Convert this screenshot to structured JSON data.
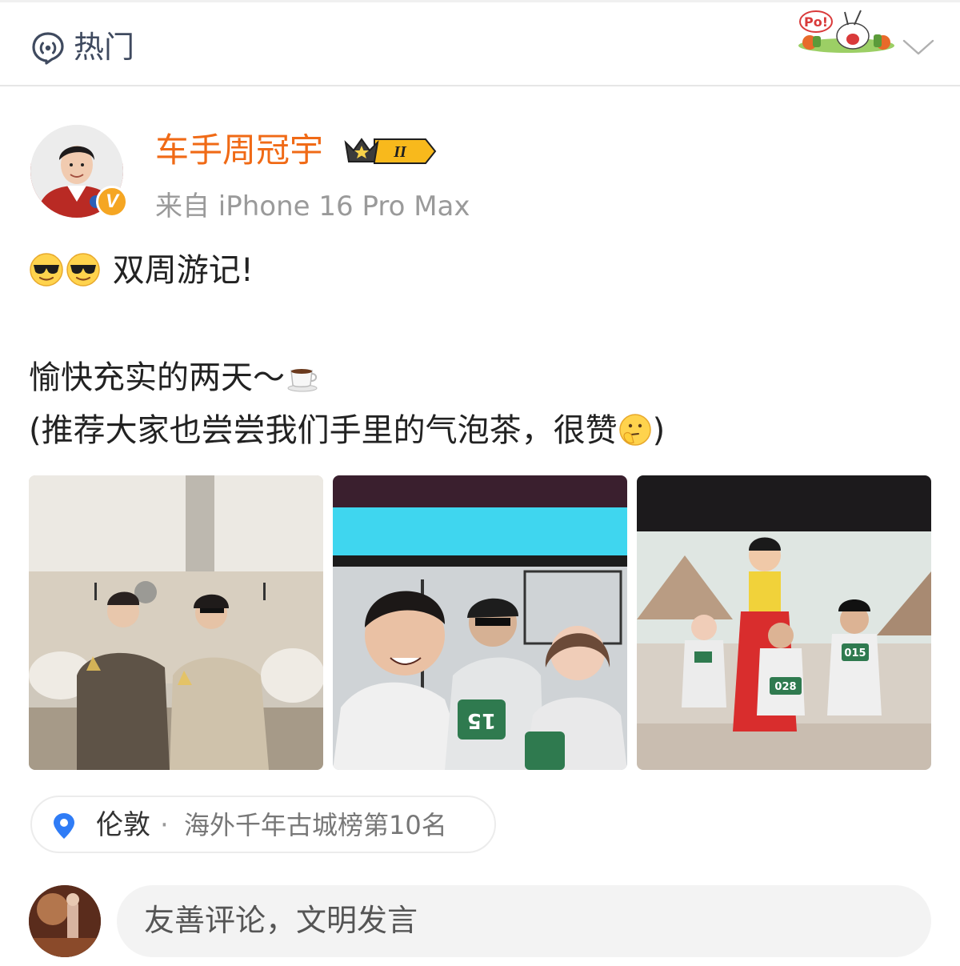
{
  "header": {
    "title": "热门",
    "sticker_text": "Po!"
  },
  "post": {
    "author": {
      "name": "车手周冠宇",
      "vip_level": "II",
      "verified_badge": "V",
      "source": "来自 iPhone 16 Pro Max"
    },
    "text": {
      "line1": "双周游记!",
      "line2": "愉快充实的两天～",
      "line3_open": "(推荐大家也尝尝我们手里的气泡茶，很赞",
      "line3_close": ")"
    },
    "photo_labels": {
      "photo2_bib": "15",
      "photo3_bib_left": "028",
      "photo3_bib_right": "015"
    },
    "location": {
      "city": "伦敦",
      "separator": "·",
      "rank": "海外千年古城榜第10名"
    }
  },
  "comment": {
    "placeholder": "友善评论，文明发言"
  },
  "colors": {
    "accent_orange": "#f06a16",
    "header_text": "#3f4a5f",
    "pin_blue": "#2f7cf6",
    "badge_gold": "#f5a623"
  },
  "icons": {
    "hot": "hot-topic-icon",
    "collapse": "chevron-down-icon",
    "location": "location-pin-icon",
    "emoji_cool": "cool-sunglasses-emoji",
    "emoji_coffee": "coffee-emoji",
    "emoji_think": "thinking-emoji"
  }
}
